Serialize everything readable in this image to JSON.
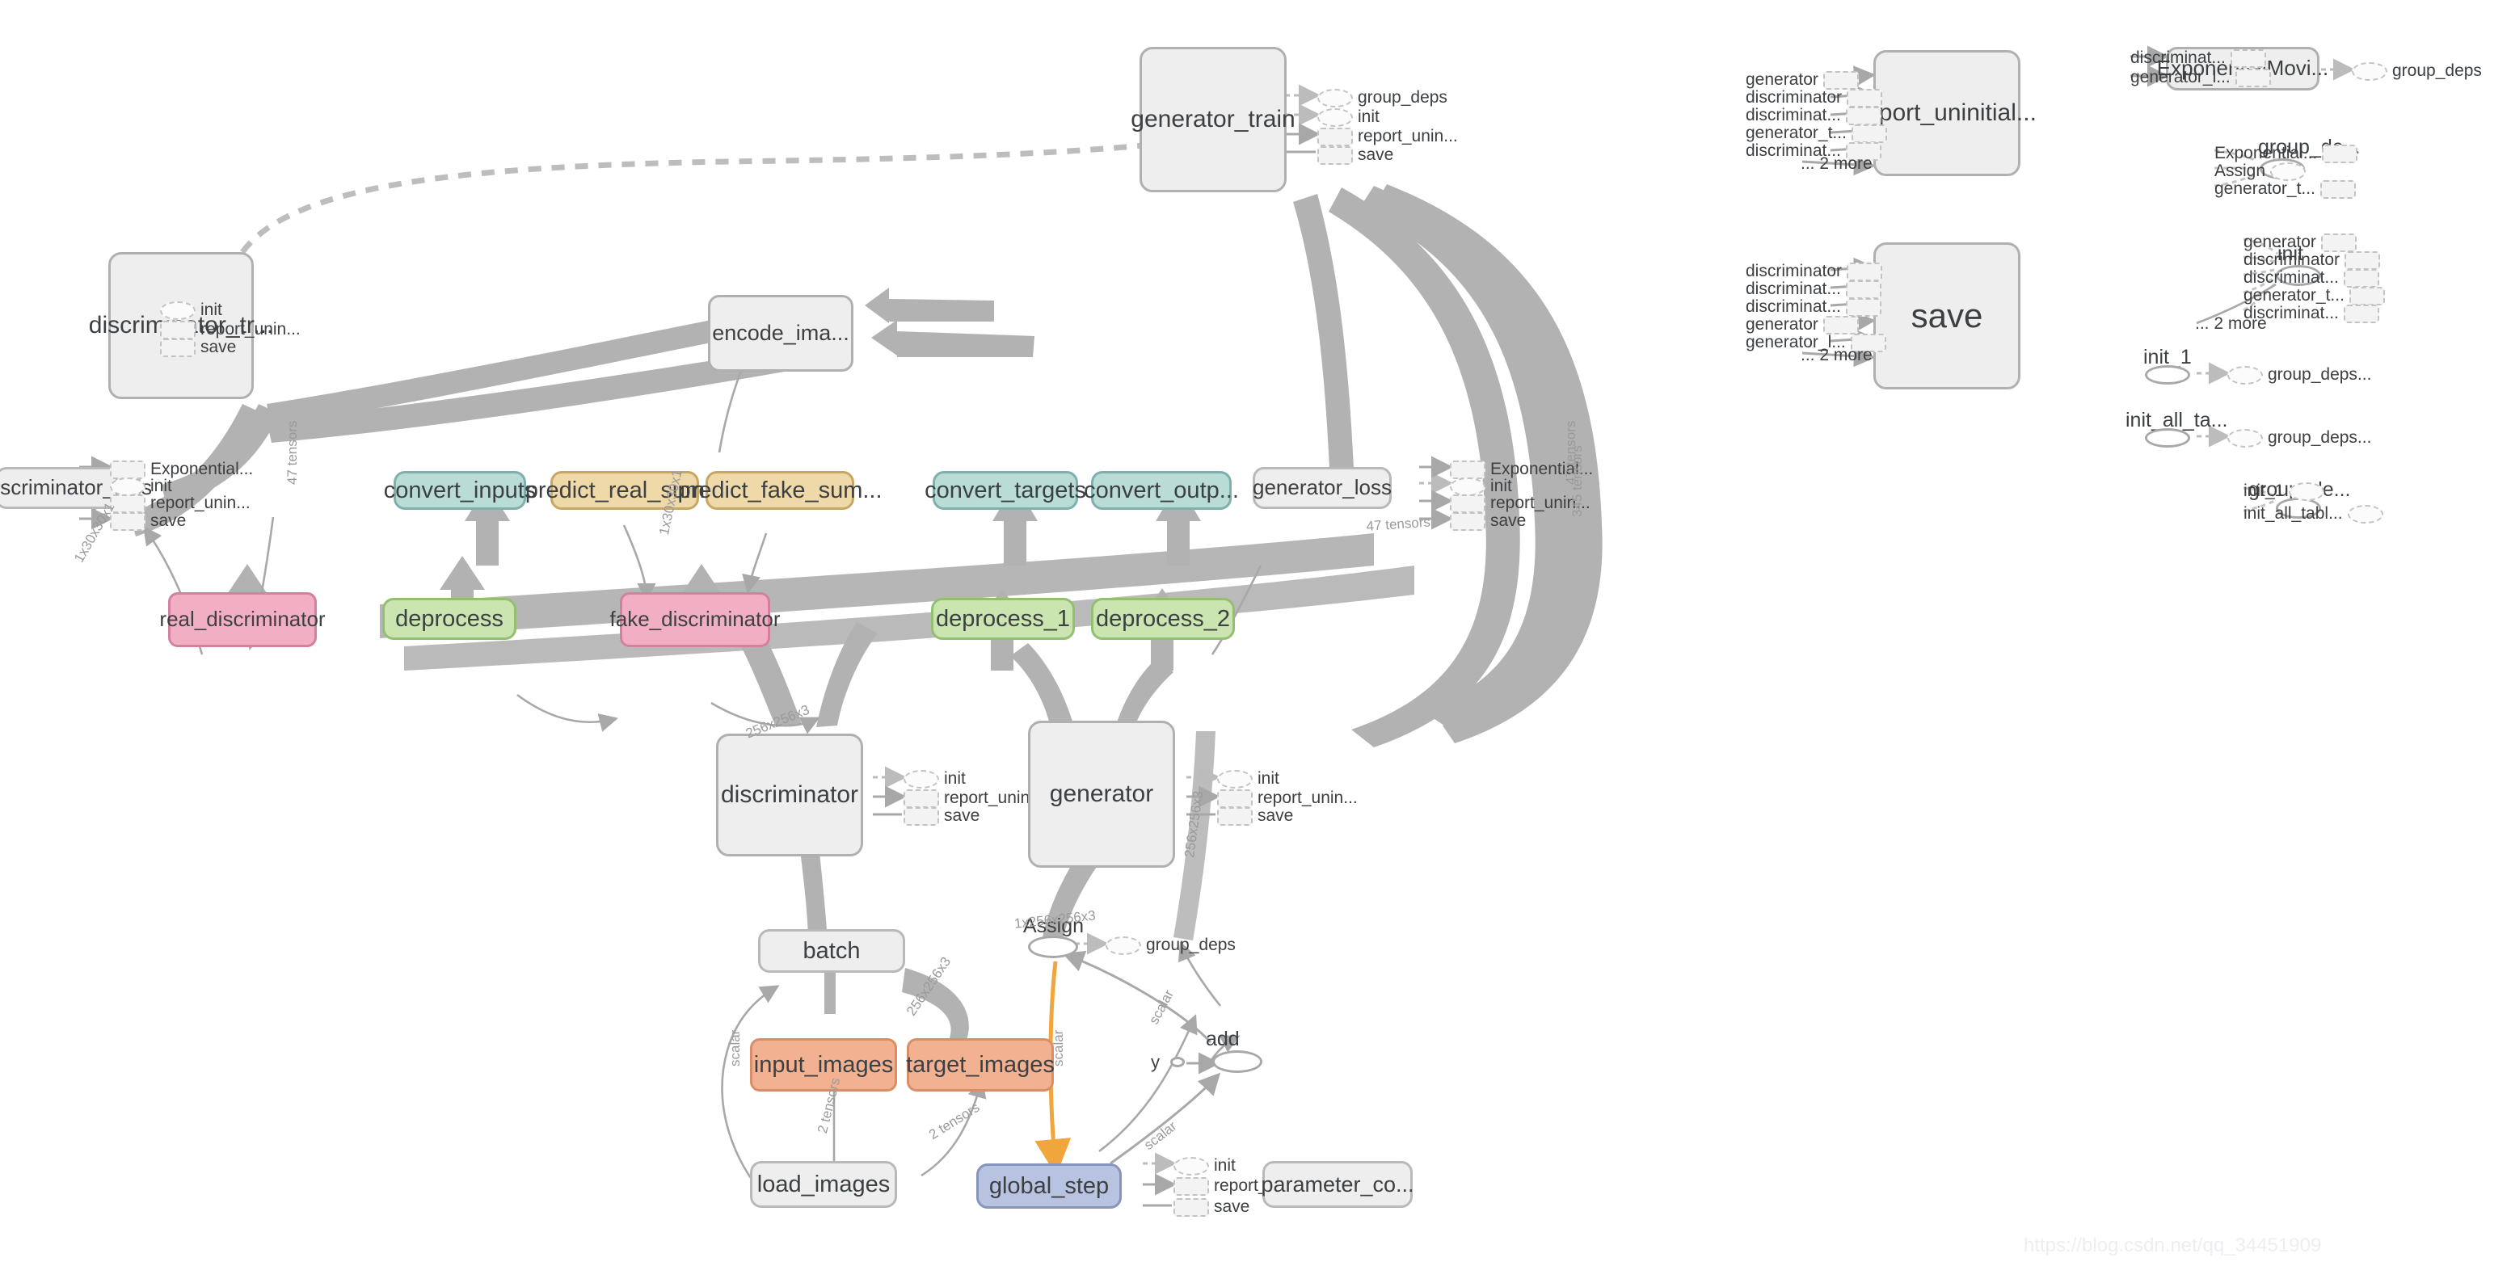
{
  "app": {
    "kind": "tensorboard-graph",
    "watermark": "https://blog.csdn.net/qq_34451909"
  },
  "colors": {
    "group_fill": "#eeeeee",
    "group_stroke": "#b0b0b0",
    "teal": "#b9dcd7",
    "tan": "#efd9a8",
    "pink": "#f2afc4",
    "green": "#cbe5b0",
    "salmon": "#f2b292",
    "blue": "#b7c3e0",
    "edge": "#aeaeae",
    "highlight_edge": "#f0a63c",
    "text": "#3c4043"
  },
  "nodes": {
    "generator_train": "generator_train",
    "discriminator_train": "discriminator_tr...",
    "encode_images": "encode_ima...",
    "discriminator_loss": "discriminator_loss",
    "convert_inputs": "convert_inputs",
    "predict_real_summary": "predict_real_sum...",
    "predict_fake_summary": "predict_fake_sum...",
    "convert_targets": "convert_targets",
    "convert_outputs": "convert_outp...",
    "generator_loss": "generator_loss",
    "real_discriminator": "real_discriminator",
    "deprocess": "deprocess",
    "fake_discriminator": "fake_discriminator",
    "deprocess_1": "deprocess_1",
    "deprocess_2": "deprocess_2",
    "discriminator": "discriminator",
    "generator": "generator",
    "batch": "batch",
    "input_images": "input_images",
    "target_images": "target_images",
    "load_images": "load_images",
    "global_step": "global_step",
    "parameter_count": "parameter_co...",
    "assign": "Assign",
    "add": "add",
    "y": "y",
    "report_uninitialized": "report_uninitial...",
    "save": "save",
    "exponential_moving_avg": "ExponentialMovi...",
    "init": "init",
    "init_1": "init_1",
    "init_all_tables": "init_all_ta...",
    "group_deps": "group_deps",
    "group_deps_ellipsis": "group_deps...",
    "group_de_ellipsis": "group_de..."
  },
  "stubs": {
    "init": "init",
    "save": "save",
    "report_uninitialized": "report_unin...",
    "report_uninit_dots": "report_unin..",
    "exponential": "Exponential...",
    "group_deps": "group_deps",
    "assign": "Assign",
    "generator": "generator",
    "discriminator": "discriminator",
    "discriminator_trunc": "discriminat...",
    "generator_t_trunc": "generator_t...",
    "generator_l_trunc": "generator_l...",
    "init_1": "init_1",
    "init_all_tabl": "init_all_tabl...",
    "two_more": "... 2 more"
  },
  "clusters": {
    "generator_train_outputs": [
      "group_deps",
      "init",
      "report_unin...",
      "save"
    ],
    "discriminator_train_outputs": [
      "init",
      "report_unin...",
      "save"
    ],
    "discriminator_loss_outputs": [
      "Exponential...",
      "init",
      "report_unin...",
      "save"
    ],
    "generator_loss_outputs": [
      "Exponential...",
      "init",
      "report_unin...",
      "save"
    ],
    "discriminator_outputs": [
      "init",
      "report_unin...",
      "save"
    ],
    "generator_outputs": [
      "init",
      "report_unin...",
      "save"
    ],
    "global_step_outputs": [
      "init",
      "report_unin..",
      "save"
    ],
    "report_uninitialized_inputs": [
      "generator",
      "discriminator",
      "discriminat...",
      "generator_t...",
      "discriminat...",
      "... 2 more"
    ],
    "save_inputs": [
      "discriminator",
      "discriminat...",
      "discriminat...",
      "generator",
      "generator_l...",
      "... 2 more"
    ],
    "ema_inputs": [
      "discriminat...",
      "generator_l..."
    ],
    "ema_outputs": [
      "group_deps"
    ],
    "group_de_inputs": [
      "Exponential...",
      "Assign",
      "generator_t..."
    ],
    "init_inputs": [
      "generator",
      "discriminator",
      "discriminat...",
      "generator_t...",
      "discriminat...",
      "... 2 more"
    ],
    "init_1_outputs": [
      "group_deps..."
    ],
    "init_all_tables_outputs": [
      "group_deps..."
    ],
    "group_de2_inputs": [
      "init_1",
      "init_all_tabl..."
    ]
  },
  "edge_labels": {
    "tensors_47": "47 tensors",
    "tensors_345": "345 tensors",
    "tensors_2": "2 tensors",
    "scalar": "scalar",
    "shape_256": "256x256x3",
    "shape_1_256": "1x256x256x3",
    "shape_1_30": "1x30x30x1",
    "shape_3": "x3"
  }
}
